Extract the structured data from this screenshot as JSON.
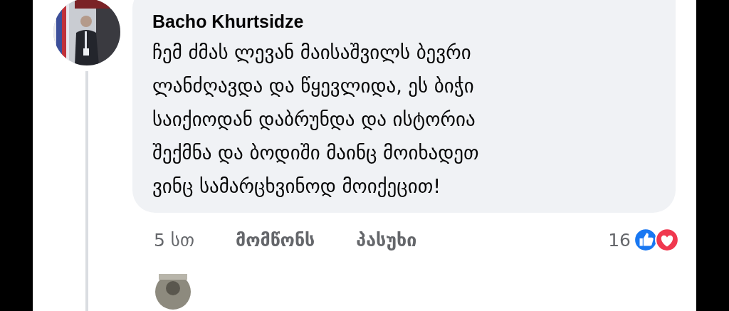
{
  "comment": {
    "author": "Bacho Khurtsidze",
    "text": "ჩემ ძმას ლევან მაისაშვილს ბევრი\nლანძღავდა და წყევლიდა, ეს ბიჭი\nსაიქიოდან დაბრუნდა და ისტორია\nშექმნა და ბოდიში მაინც მოიხადეთ\nვინც სამარცხვინოდ მოიქეცით!",
    "time": "5 სთ",
    "actions": [
      "მომწონს",
      "პასუხი"
    ],
    "reaction_count": "16",
    "reactions": [
      {
        "kind": "like",
        "color": "#1877f2"
      },
      {
        "kind": "love",
        "color": "#f0384f"
      }
    ]
  }
}
